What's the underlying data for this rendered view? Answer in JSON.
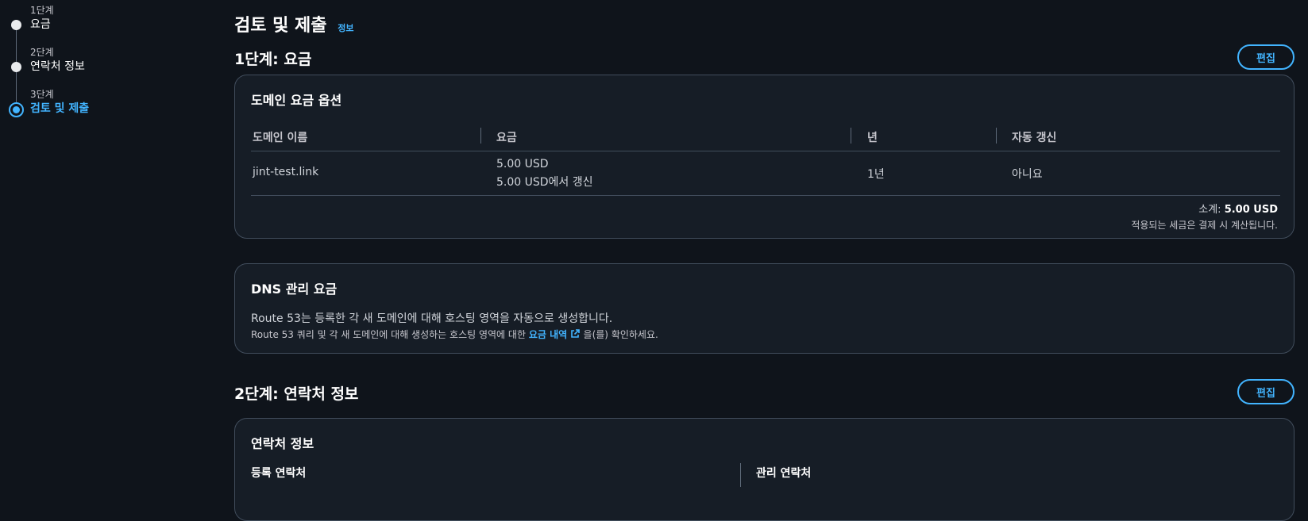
{
  "stepper": {
    "steps": [
      {
        "num": "1단계",
        "label": "요금"
      },
      {
        "num": "2단계",
        "label": "연락처 정보"
      },
      {
        "num": "3단계",
        "label": "검토 및 제출"
      }
    ]
  },
  "page": {
    "title": "검토 및 제출",
    "info_link": "정보"
  },
  "step1": {
    "title": "1단계: 요금",
    "edit_label": "편집",
    "card": {
      "title": "도메인 요금 옵션",
      "headers": [
        "도메인 이름",
        "요금",
        "년",
        "자동 갱신"
      ],
      "row": {
        "domain": "jint-test.link",
        "price": "5.00 USD",
        "renewal": "5.00 USD에서 갱신",
        "years": "1년",
        "auto_renew": "아니요"
      },
      "subtotal_label": "소계:",
      "subtotal_value": "5.00 USD",
      "tax_note": "적용되는 세금은 결제 시 계산됩니다."
    }
  },
  "dns": {
    "title": "DNS 관리 요금",
    "line1": "Route 53는 등록한 각 새 도메인에 대해 호스팅 영역을 자동으로 생성합니다.",
    "line2_prefix": "Route 53 쿼리 및 각 새 도메인에 대해 생성하는 호스팅 영역에 대한",
    "line2_link": "요금 내역",
    "line2_suffix": "을(를) 확인하세요.",
    "link_icon": "external-link-icon"
  },
  "step2": {
    "title": "2단계: 연락처 정보",
    "edit_label": "편집",
    "card": {
      "title": "연락처 정보",
      "col1": "등록 연락처",
      "col2": "관리 연락처"
    }
  },
  "colors": {
    "background": "#0f141b",
    "card": "#161d26",
    "accent": "#42b4ff",
    "border": "#414d5c"
  }
}
